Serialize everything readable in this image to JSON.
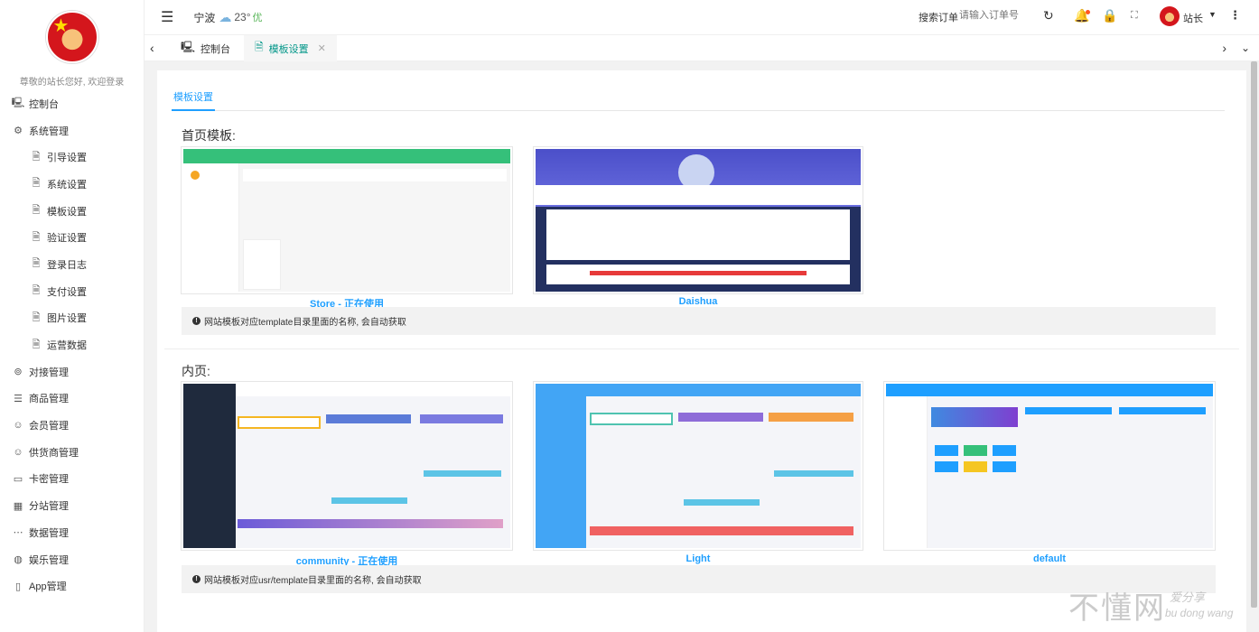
{
  "sidebar": {
    "welcome": "尊敬的站长您好, 欢迎登录",
    "items": [
      {
        "icon": "monitor-icon",
        "glyph": "🖳",
        "label": "控制台",
        "sub": false
      },
      {
        "icon": "gear-icon",
        "glyph": "⚙",
        "label": "系统管理",
        "sub": false
      },
      {
        "icon": "file-icon",
        "glyph": "🗎",
        "label": "引导设置",
        "sub": true
      },
      {
        "icon": "file-icon",
        "glyph": "🗎",
        "label": "系统设置",
        "sub": true
      },
      {
        "icon": "file-icon",
        "glyph": "🗎",
        "label": "模板设置",
        "sub": true
      },
      {
        "icon": "file-icon",
        "glyph": "🗎",
        "label": "验证设置",
        "sub": true
      },
      {
        "icon": "file-icon",
        "glyph": "🗎",
        "label": "登录日志",
        "sub": true
      },
      {
        "icon": "file-icon",
        "glyph": "🗎",
        "label": "支付设置",
        "sub": true
      },
      {
        "icon": "file-icon",
        "glyph": "🗎",
        "label": "图片设置",
        "sub": true
      },
      {
        "icon": "file-icon",
        "glyph": "🗎",
        "label": "运营数据",
        "sub": true
      },
      {
        "icon": "link-icon",
        "glyph": "⊚",
        "label": "对接管理",
        "sub": false
      },
      {
        "icon": "database-icon",
        "glyph": "☰",
        "label": "商品管理",
        "sub": false
      },
      {
        "icon": "user-icon",
        "glyph": "☺",
        "label": "会员管理",
        "sub": false
      },
      {
        "icon": "user-icon",
        "glyph": "☺",
        "label": "供货商管理",
        "sub": false
      },
      {
        "icon": "card-icon",
        "glyph": "▭",
        "label": "卡密管理",
        "sub": false
      },
      {
        "icon": "grid-icon",
        "glyph": "▦",
        "label": "分站管理",
        "sub": false
      },
      {
        "icon": "dots-icon",
        "glyph": "⋯",
        "label": "数据管理",
        "sub": false
      },
      {
        "icon": "game-icon",
        "glyph": "◍",
        "label": "娱乐管理",
        "sub": false
      },
      {
        "icon": "phone-icon",
        "glyph": "▯",
        "label": "App管理",
        "sub": false
      }
    ]
  },
  "header": {
    "city": "宁波",
    "temperature": "23°",
    "air_quality": "优",
    "search_label": "搜索订单",
    "search_placeholder": "请输入订单号",
    "user_name": "站长"
  },
  "tabs": [
    {
      "label": "控制台",
      "icon": "monitor-icon",
      "active": false
    },
    {
      "label": "模板设置",
      "icon": "file-icon",
      "active": true
    }
  ],
  "page": {
    "subtab": "模板设置",
    "home_section_title": "首页模板:",
    "inner_section_title": "内页:",
    "home_templates": [
      {
        "name": "Store - 正在使用"
      },
      {
        "name": "Daishua"
      }
    ],
    "inner_templates": [
      {
        "name": "community - 正在使用"
      },
      {
        "name": "Light"
      },
      {
        "name": "default"
      }
    ],
    "home_notice": "网站模板对应template目录里面的名称, 会自动获取",
    "inner_notice": "网站模板对应usr/template目录里面的名称, 会自动获取"
  },
  "watermark": {
    "text": "不懂网",
    "small": "爱分享",
    "pinyin": "bu dong wang"
  },
  "colors": {
    "accent": "#1e9fff",
    "active_tab": "#009688"
  }
}
